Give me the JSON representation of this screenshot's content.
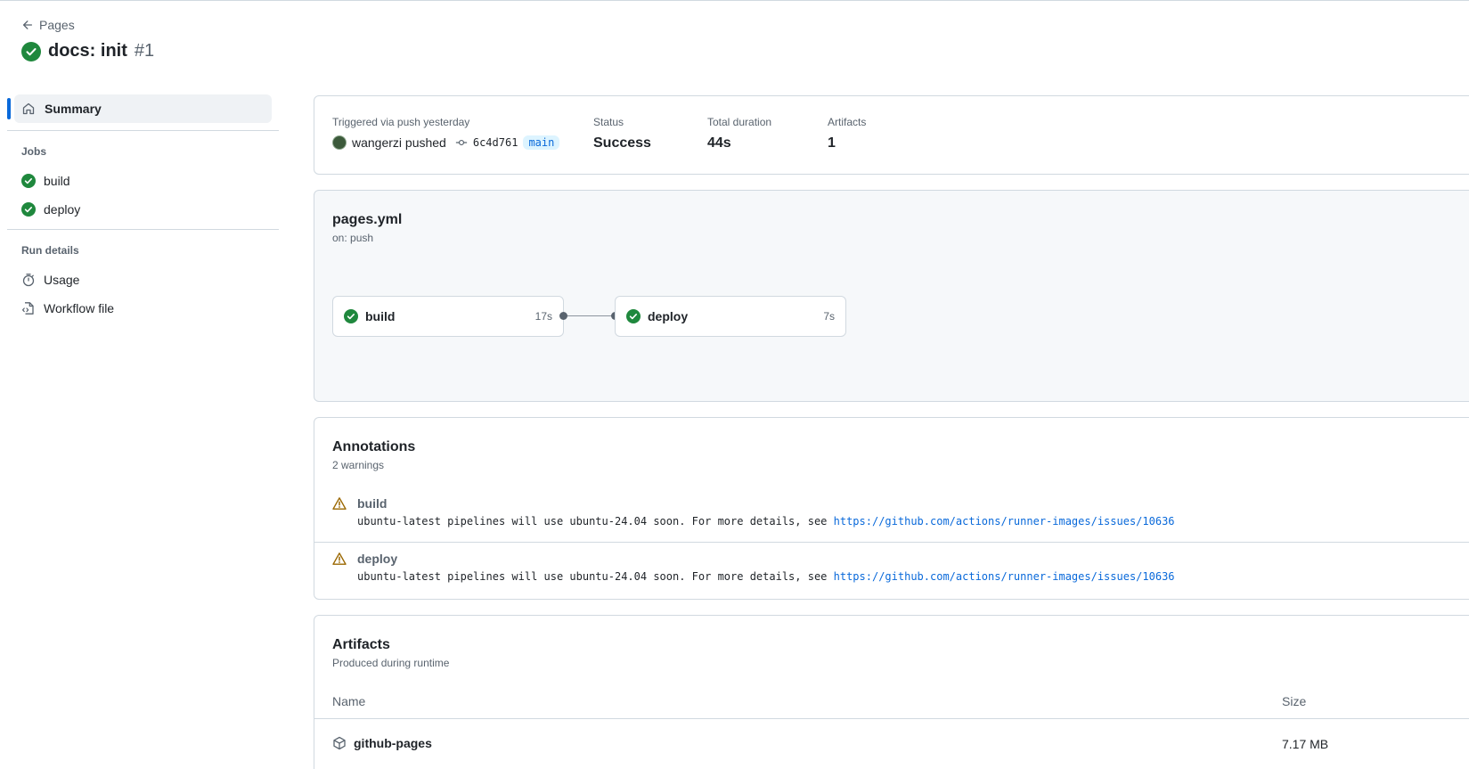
{
  "header": {
    "back_label": "Pages",
    "run_title": "docs: init",
    "run_number": "#1"
  },
  "sidebar": {
    "summary_label": "Summary",
    "jobs_heading": "Jobs",
    "jobs": [
      {
        "label": "build",
        "status": "success"
      },
      {
        "label": "deploy",
        "status": "success"
      }
    ],
    "run_details_heading": "Run details",
    "details": [
      {
        "label": "Usage",
        "icon": "stopwatch-icon"
      },
      {
        "label": "Workflow file",
        "icon": "file-code-icon"
      }
    ]
  },
  "trigger": {
    "label": "Triggered via push yesterday",
    "actor": "wangerzi pushed",
    "commit": "6c4d761",
    "branch": "main",
    "status_label": "Status",
    "status_value": "Success",
    "duration_label": "Total duration",
    "duration_value": "44s",
    "artifacts_label": "Artifacts",
    "artifacts_value": "1"
  },
  "workflow": {
    "name": "pages.yml",
    "on": "on: push",
    "jobs": [
      {
        "name": "build",
        "duration": "17s"
      },
      {
        "name": "deploy",
        "duration": "7s"
      }
    ]
  },
  "annotations": {
    "title": "Annotations",
    "subtitle": "2 warnings",
    "items": [
      {
        "title": "build",
        "message": "ubuntu-latest pipelines will use ubuntu-24.04 soon. For more details, see ",
        "link": "https://github.com/actions/runner-images/issues/10636"
      },
      {
        "title": "deploy",
        "message": "ubuntu-latest pipelines will use ubuntu-24.04 soon. For more details, see ",
        "link": "https://github.com/actions/runner-images/issues/10636"
      }
    ]
  },
  "artifacts": {
    "title": "Artifacts",
    "subtitle": "Produced during runtime",
    "col_name": "Name",
    "col_size": "Size",
    "rows": [
      {
        "name": "github-pages",
        "size": "7.17 MB"
      }
    ]
  },
  "colors": {
    "success": "#1f883d",
    "warning": "#9a6700",
    "link": "#0969da",
    "accent": "#0969da"
  }
}
